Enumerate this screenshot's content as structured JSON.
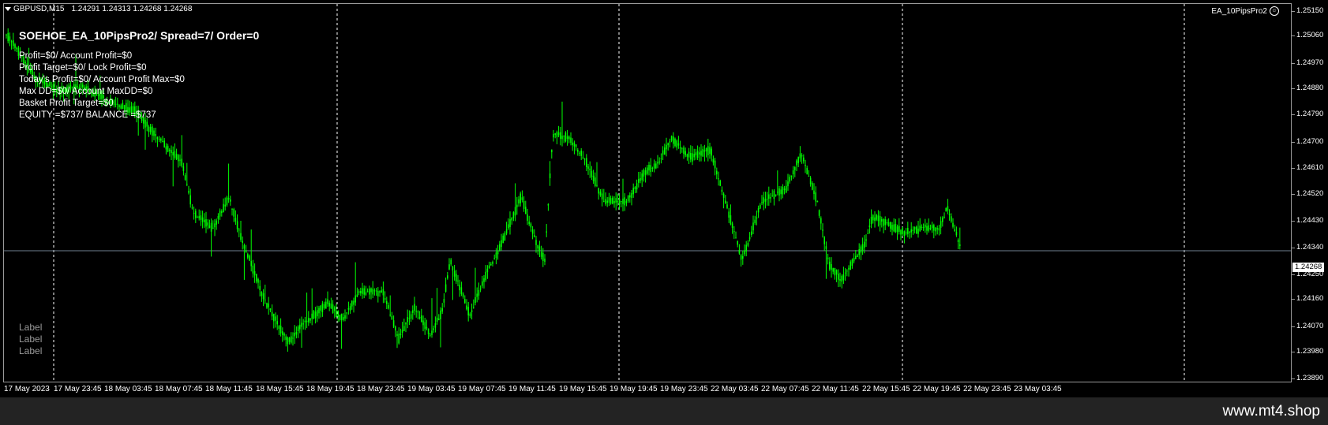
{
  "header": {
    "symbol": "GBPUSD,M15",
    "ohlc": "1.24291 1.24313 1.24268 1.24268",
    "ea_badge": "EA_10PipsPro2",
    "smiley_icon": "smiley-icon"
  },
  "ea_panel": {
    "title": "SOEHOE_EA_10PipsPro2/ Spread=7/ Order=0",
    "lines": [
      "Profit=$0/ Account Profit=$0",
      "Profit Target=$0/ Lock Profit=$0",
      "Today's Profit=$0/ Account Profit Max=$0",
      "Max DD=$0/ Account MaxDD=$0",
      "Basket Profit Target=$0",
      "EQUITY =$737/ BALANCE =$737"
    ],
    "labels": [
      "Label",
      "Label",
      "Label"
    ]
  },
  "price_axis": {
    "ticks": [
      "1.25150",
      "1.25060",
      "1.24970",
      "1.24880",
      "1.24790",
      "1.24700",
      "1.24610",
      "1.24520",
      "1.24430",
      "1.24340",
      "1.24250",
      "1.24160",
      "1.24070",
      "1.23980",
      "1.23890"
    ],
    "current_price": "1.24268"
  },
  "time_axis": {
    "ticks": [
      "17 May 2023",
      "17 May 23:45",
      "18 May 03:45",
      "18 May 07:45",
      "18 May 11:45",
      "18 May 15:45",
      "18 May 19:45",
      "18 May 23:45",
      "19 May 03:45",
      "19 May 07:45",
      "19 May 11:45",
      "19 May 15:45",
      "19 May 19:45",
      "19 May 23:45",
      "22 May 03:45",
      "22 May 07:45",
      "22 May 11:45",
      "22 May 15:45",
      "22 May 19:45",
      "22 May 23:45",
      "23 May 03:45"
    ]
  },
  "colors": {
    "background": "#000000",
    "candle": "#00ff00",
    "grid": "#ffffff",
    "current_price_line": "#6f8090",
    "text": "#ffffff"
  },
  "footer": {
    "watermark": "www.mt4.shop"
  }
}
